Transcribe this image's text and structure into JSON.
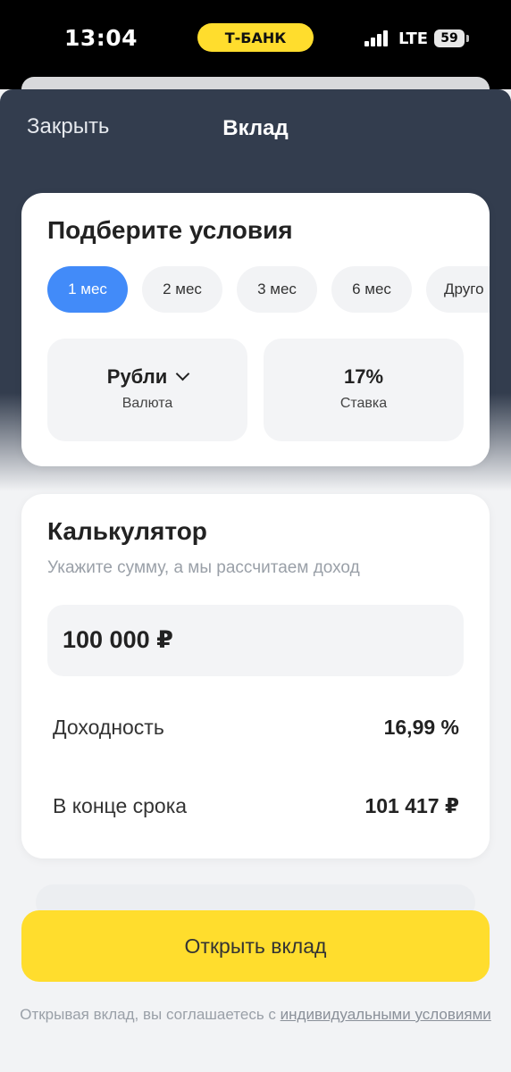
{
  "status_bar": {
    "time": "13:04",
    "carrier_badge": "Т-БАНК",
    "network": "LTE",
    "battery": "59"
  },
  "header": {
    "close_label": "Закрыть",
    "title": "Вклад"
  },
  "conditions": {
    "title": "Подберите условия",
    "terms": [
      {
        "label": "1 мес",
        "selected": true
      },
      {
        "label": "2 мес",
        "selected": false
      },
      {
        "label": "3 мес",
        "selected": false
      },
      {
        "label": "6 мес",
        "selected": false
      },
      {
        "label": "Друго",
        "selected": false
      }
    ],
    "currency": {
      "value": "Рубли",
      "label": "Валюта"
    },
    "rate": {
      "value": "17%",
      "label": "Ставка"
    }
  },
  "calculator": {
    "title": "Калькулятор",
    "subtitle": "Укажите сумму, а мы рассчитаем доход",
    "amount": "100 000 ₽",
    "rows": [
      {
        "label": "Доходность",
        "value": "16,99 %"
      },
      {
        "label": "В конце срока",
        "value": "101 417 ₽"
      }
    ]
  },
  "footer": {
    "open_button": "Открыть вклад",
    "agreement_text": "Открывая вклад, вы соглашаетесь с",
    "agreement_link": "индивидуальными условиями"
  },
  "colors": {
    "accent_yellow": "#ffdd2d",
    "selected_chip": "#428bf9",
    "header_bg": "#333d4e"
  }
}
